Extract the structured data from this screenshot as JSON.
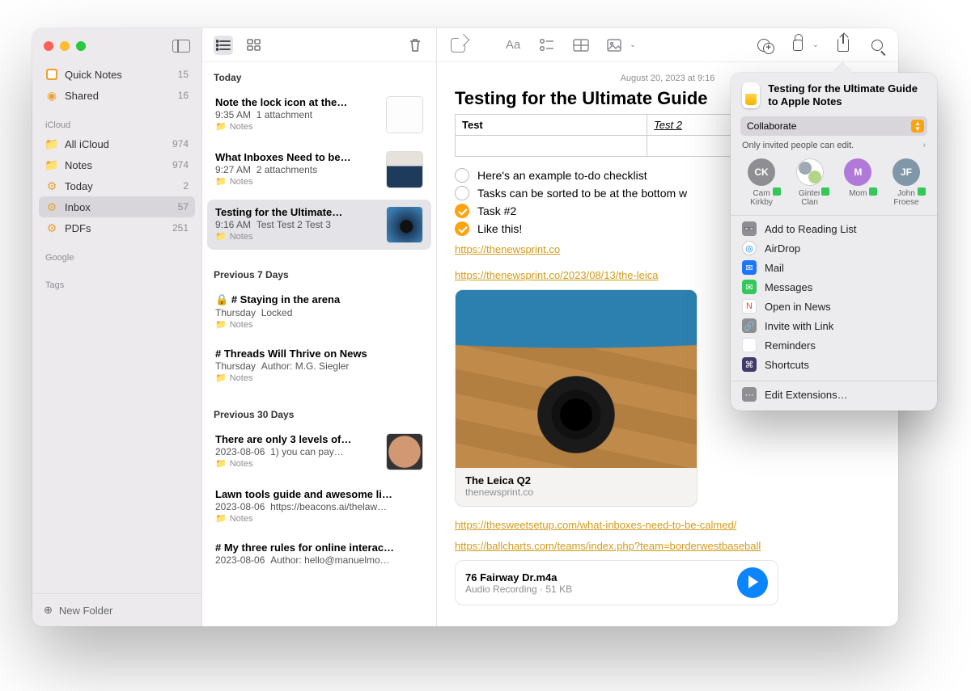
{
  "sidebar": {
    "sections": [
      {
        "label": null,
        "items": [
          {
            "name": "Quick Notes",
            "count": "15",
            "icon": "qn"
          },
          {
            "name": "Shared",
            "count": "16",
            "icon": "shared"
          }
        ]
      },
      {
        "label": "iCloud",
        "items": [
          {
            "name": "All iCloud",
            "count": "974",
            "icon": "folder"
          },
          {
            "name": "Notes",
            "count": "974",
            "icon": "folder"
          },
          {
            "name": "Today",
            "count": "2",
            "icon": "gear"
          },
          {
            "name": "Inbox",
            "count": "57",
            "icon": "gear",
            "selected": true
          },
          {
            "name": "PDFs",
            "count": "251",
            "icon": "gear"
          }
        ]
      },
      {
        "label": "Google",
        "items": []
      },
      {
        "label": "Tags",
        "items": []
      }
    ],
    "new_folder": "New Folder"
  },
  "list": {
    "groups": [
      {
        "header": "Today",
        "notes": [
          {
            "title": "Note the lock icon at the…",
            "time": "9:35 AM",
            "snippet": "1 attachment",
            "folder": "Notes",
            "thumb": "white"
          },
          {
            "title": "What Inboxes Need to be…",
            "time": "9:27 AM",
            "snippet": "2 attachments",
            "folder": "Notes",
            "thumb": "photo"
          },
          {
            "title": "Testing for the Ultimate…",
            "time": "9:16 AM",
            "snippet": "Test Test 2 Test 3",
            "folder": "Notes",
            "thumb": "camera",
            "selected": true
          }
        ]
      },
      {
        "header": "Previous 7 Days",
        "notes": [
          {
            "title": "# Staying in the arena",
            "time": "Thursday",
            "snippet": "Locked",
            "folder": "Notes",
            "lock": true
          },
          {
            "title": "# Threads Will Thrive on News",
            "time": "Thursday",
            "snippet": "Author: M.G. Siegler",
            "folder": "Notes"
          }
        ]
      },
      {
        "header": "Previous 30 Days",
        "notes": [
          {
            "title": "There are only 3 levels of…",
            "time": "2023-08-06",
            "snippet": "1) you can pay…",
            "folder": "Notes",
            "thumb": "face"
          },
          {
            "title": "Lawn tools guide and awesome li…",
            "time": "2023-08-06",
            "snippet": "https://beacons.ai/thelaw…",
            "folder": "Notes"
          },
          {
            "title": "# My three rules for online interac…",
            "time": "2023-08-06",
            "snippet": "Author: hello@manuelmo…"
          }
        ]
      }
    ]
  },
  "editor": {
    "date": "August 20, 2023 at 9:16",
    "title": "Testing for the Ultimate Guide",
    "table": {
      "r1c1": "Test",
      "r1c2": "Test 2"
    },
    "todos": [
      {
        "done": false,
        "text": "Here's an example to-do checklist"
      },
      {
        "done": false,
        "text": "Tasks can be sorted to be at the bottom w"
      },
      {
        "done": true,
        "text": "Task #2"
      },
      {
        "done": true,
        "text": "Like this!"
      }
    ],
    "link1": "https://thenewsprint.co",
    "link2": "https://thenewsprint.co/2023/08/13/the-leica",
    "card": {
      "title": "The Leica Q2",
      "domain": "thenewsprint.co"
    },
    "link3": "https://thesweetsetup.com/what-inboxes-need-to-be-calmed/",
    "link4": "https://ballcharts.com/teams/index.php?team=borderwestbaseball",
    "audio": {
      "title": "76 Fairway Dr.m4a",
      "sub": "Audio Recording · 51 KB"
    }
  },
  "share": {
    "title": "Testing for the Ultimate Guide to Apple Notes",
    "mode": "Collaborate",
    "permission": "Only invited people can edit.",
    "people": [
      {
        "initials": "CK",
        "name": "Cam Kirkby",
        "style": ""
      },
      {
        "initials": "",
        "name": "Ginter Clan",
        "style": "grp"
      },
      {
        "initials": "M",
        "name": "Mom",
        "style": "purple"
      },
      {
        "initials": "JF",
        "name": "John Froese",
        "style": "blue"
      }
    ],
    "apps": [
      {
        "icon": "grey",
        "glyph": "👓",
        "label": "Add to Reading List"
      },
      {
        "icon": "airdrop",
        "glyph": "◎",
        "label": "AirDrop"
      },
      {
        "icon": "mail",
        "glyph": "✉︎",
        "label": "Mail"
      },
      {
        "icon": "msg",
        "glyph": "✉︎",
        "label": "Messages"
      },
      {
        "icon": "news",
        "glyph": "N",
        "label": "Open in News"
      },
      {
        "icon": "link",
        "glyph": "🔗",
        "label": "Invite with Link"
      },
      {
        "icon": "rem",
        "glyph": "☰",
        "label": "Reminders"
      },
      {
        "icon": "sc",
        "glyph": "⌘",
        "label": "Shortcuts"
      }
    ],
    "edit_ext": "Edit Extensions…"
  }
}
